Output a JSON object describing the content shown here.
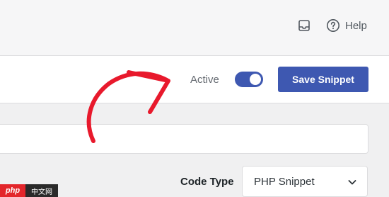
{
  "topbar": {
    "inbox_icon": "inbox-icon",
    "help_icon": "question-circle-icon",
    "help_label": "Help"
  },
  "actionbar": {
    "active_label": "Active",
    "toggle_on": true,
    "save_label": "Save Snippet"
  },
  "editor": {
    "title_value": "",
    "code_type_label": "Code Type",
    "code_type_value": "PHP Snippet",
    "chevron_icon": "chevron-down-icon"
  },
  "watermark": {
    "left": "php",
    "right": "中文网"
  },
  "colors": {
    "accent": "#3e58b1",
    "annotation": "#e8192c"
  }
}
